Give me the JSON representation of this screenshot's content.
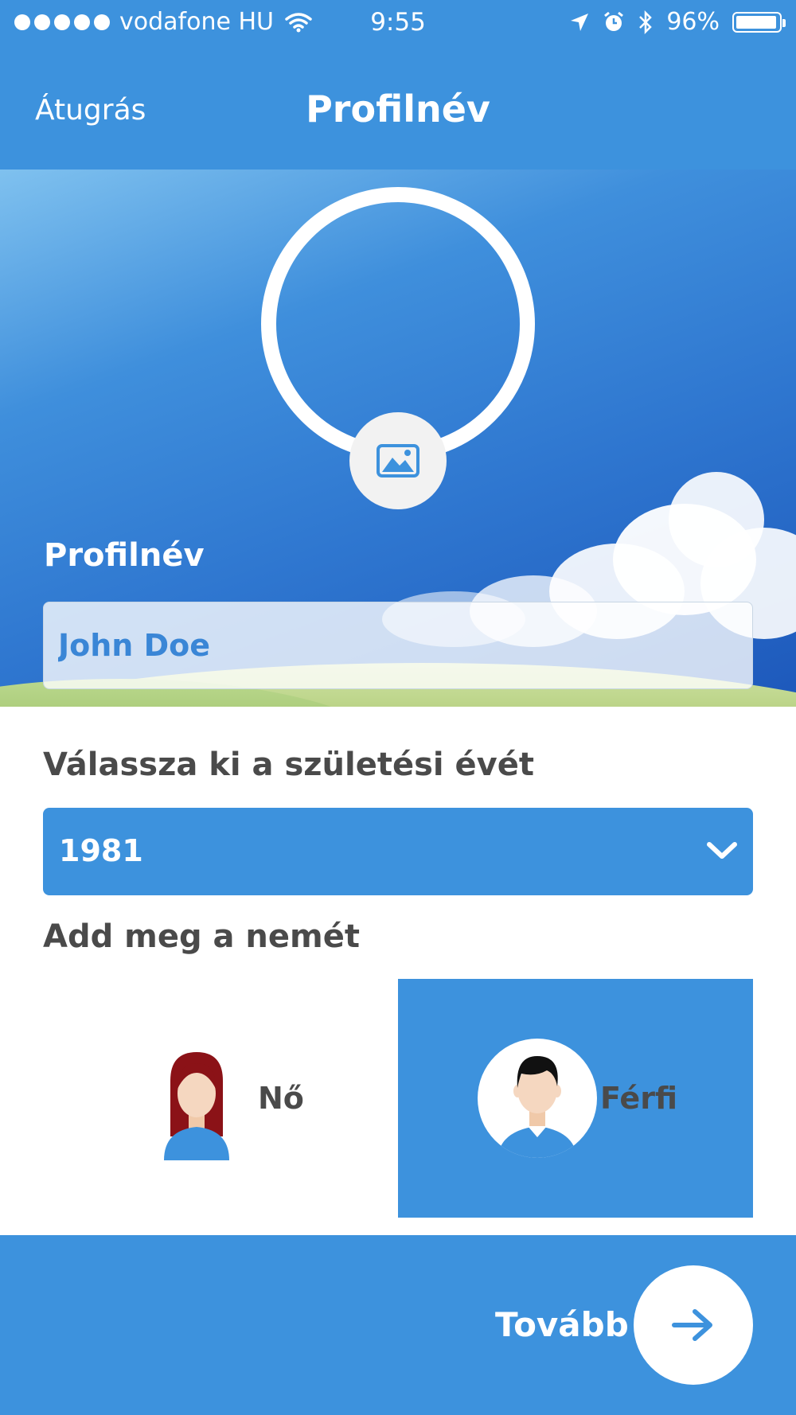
{
  "status_bar": {
    "carrier": "vodafone HU",
    "time": "9:55",
    "battery": "96%",
    "icons": [
      "signal-dots-icon",
      "wifi-icon",
      "location-arrow-icon",
      "alarm-icon",
      "bluetooth-icon",
      "battery-icon"
    ]
  },
  "nav": {
    "skip_label": "Átugrás",
    "title": "Profilnév"
  },
  "profile": {
    "name_label": "Profilnév",
    "name_value": "John Doe",
    "photo_icon": "image-icon"
  },
  "birth_year": {
    "label": "Válassza ki a születési évét",
    "selected": "1981"
  },
  "gender": {
    "label": "Add meg a nemét",
    "female_label": "Nő",
    "male_label": "Férfi",
    "selected": "male"
  },
  "footer": {
    "next_label": "Tovább",
    "next_icon": "arrow-right-icon"
  },
  "colors": {
    "accent": "#3d92dd",
    "text_dark": "#4a4a4a",
    "female_hair": "#8b1217",
    "skin": "#f5d7c0"
  }
}
